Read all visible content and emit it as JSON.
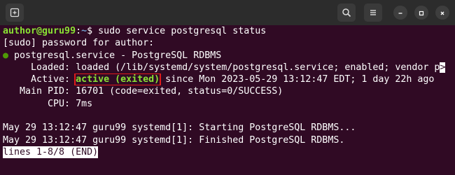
{
  "window": {
    "new_tab_icon": "new-tab-icon",
    "search_icon": "search-icon",
    "menu_icon": "hamburger-menu-icon",
    "minimize_icon": "minimize-icon",
    "maximize_icon": "maximize-icon",
    "close_icon": "close-icon"
  },
  "terminal": {
    "prompt_user": "author@guru99",
    "prompt_sep": ":",
    "prompt_path": "~",
    "prompt_end": "$ ",
    "command": "sudo service postgresql status",
    "sudo_prompt": "[sudo] password for author:",
    "service_dot": "●",
    "service_line": " postgresql.service - PostgreSQL RDBMS",
    "loaded_label": "     Loaded: ",
    "loaded_value": "loaded (/lib/systemd/system/postgresql.service; enabled; vendor p",
    "truncation_marker": ">",
    "active_label": "     Active: ",
    "active_status": "active (exited)",
    "active_rest": " since Mon 2023-05-29 13:12:47 EDT; 1 day 22h ago",
    "mainpid_line": "   Main PID: 16701 (code=exited, status=0/SUCCESS)",
    "cpu_line": "        CPU: 7ms",
    "blank_line": " ",
    "log_line_1": "May 29 13:12:47 guru99 systemd[1]: Starting PostgreSQL RDBMS...",
    "log_line_2": "May 29 13:12:47 guru99 systemd[1]: Finished PostgreSQL RDBMS.",
    "pager_status": "lines 1-8/8 (END)"
  },
  "colors": {
    "background": "#300a24",
    "prompt_user": "#8ae234",
    "prompt_path": "#729fcf",
    "active_status": "#8ae234",
    "highlight_box": "#e01b1b"
  }
}
